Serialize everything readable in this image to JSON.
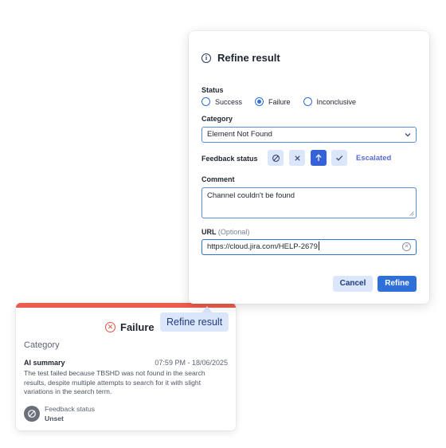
{
  "card": {
    "status": "Failure",
    "category_label": "Category",
    "ai_summary_label": "AI summary",
    "timestamp": "07:59 PM - 18/06/2025",
    "summary": "The test failed because TBSHD was not found in the search results, despite multiple attempts to search for it with slight variations in the search term.",
    "feedback_label": "Feedback status",
    "feedback_value": "Unset"
  },
  "tooltip": {
    "label": "Refine result"
  },
  "dialog": {
    "title": "Refine result",
    "status_label": "Status",
    "status_options": [
      "Success",
      "Failure",
      "Inconclusive"
    ],
    "status_selected": "Failure",
    "category_label": "Category",
    "category_value": "Element Not Found",
    "feedback_label": "Feedback status",
    "feedback_value": "Escalated",
    "comment_label": "Comment",
    "comment_value": "Channel couldn't be found",
    "url_label": "URL",
    "url_optional": "(Optional)",
    "url_value": "https://cloud.jira.com/HELP-2679",
    "cancel_label": "Cancel",
    "refine_label": "Refine"
  },
  "colors": {
    "primary": "#2f6fd8",
    "primary_light": "#dbe6fb",
    "failure": "#e2513f",
    "failure_bar": "#ec5c4c",
    "escalated": "#5a6cd4"
  }
}
